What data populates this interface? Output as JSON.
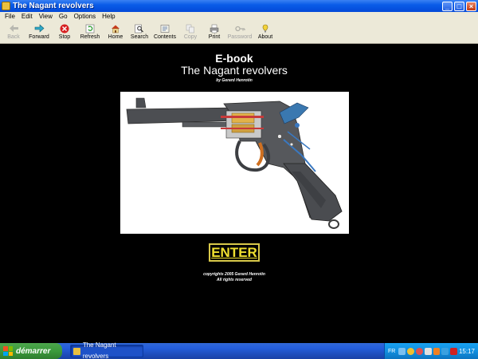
{
  "window": {
    "title": "The Nagant revolvers"
  },
  "menu": [
    "File",
    "Edit",
    "View",
    "Go",
    "Options",
    "Help"
  ],
  "toolbar": [
    {
      "label": "Back",
      "icon": "arrow-left-icon",
      "enabled": false
    },
    {
      "label": "Forward",
      "icon": "arrow-right-icon",
      "enabled": true
    },
    {
      "label": "Stop",
      "icon": "stop-icon",
      "enabled": true
    },
    {
      "label": "Refresh",
      "icon": "refresh-icon",
      "enabled": true
    },
    {
      "label": "Home",
      "icon": "home-icon",
      "enabled": true
    },
    {
      "label": "Search",
      "icon": "search-icon",
      "enabled": true
    },
    {
      "label": "Contents",
      "icon": "contents-icon",
      "enabled": true
    },
    {
      "label": "Copy",
      "icon": "copy-icon",
      "enabled": false
    },
    {
      "label": "Print",
      "icon": "print-icon",
      "enabled": true
    },
    {
      "label": "Password",
      "icon": "key-icon",
      "enabled": false
    },
    {
      "label": "About",
      "icon": "about-icon",
      "enabled": true
    }
  ],
  "page": {
    "title_line1": "E-book",
    "title_line2": "The Nagant revolvers",
    "author": "by Gerard Henrotin",
    "enter_label": "ENTER",
    "copyright_line1": "copyrights 2005 Gerard Henrotin",
    "copyright_line2": "All rights reserved"
  },
  "taskbar": {
    "start_label": "démarrer",
    "task_label": "The Nagant revolvers",
    "lang": "FR",
    "clock": "15:17"
  },
  "colors": {
    "titlebar": "#0a5ce8",
    "background": "#000000",
    "enter_text": "#f0e030",
    "taskbar": "#245edc",
    "start": "#3c9a3c"
  }
}
